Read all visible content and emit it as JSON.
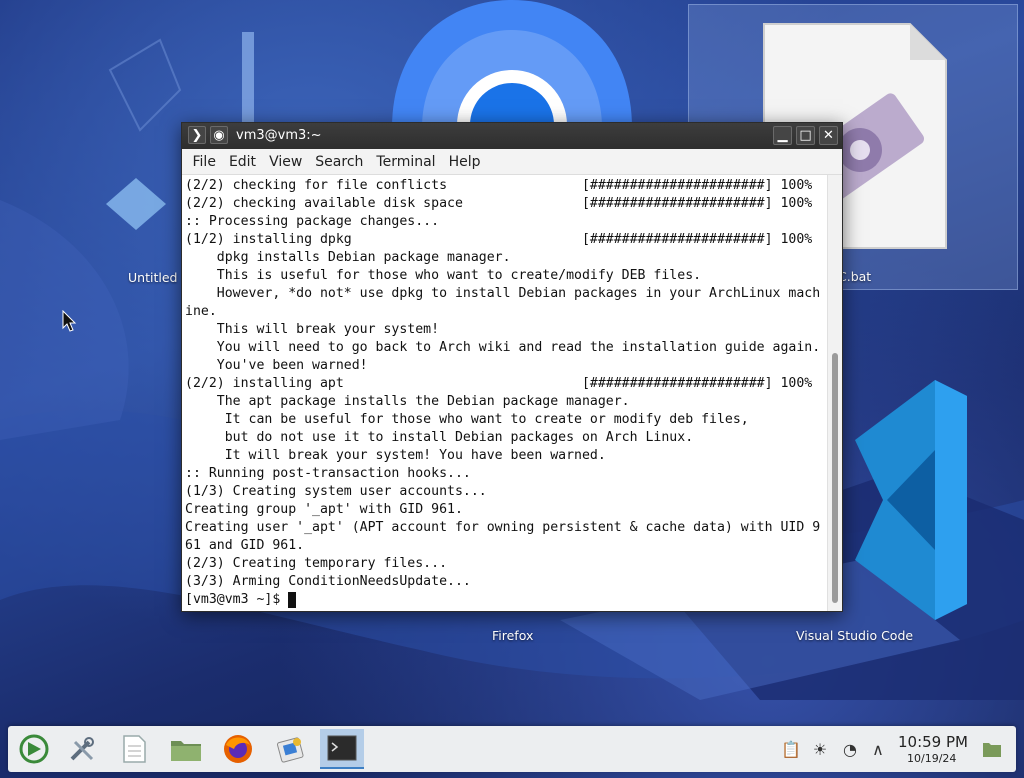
{
  "desktop": {
    "icons": [
      {
        "label": "Untitled"
      },
      {
        "label": "C.bat"
      },
      {
        "label": "Firefox"
      },
      {
        "label": "Visual Studio Code"
      }
    ]
  },
  "terminal": {
    "title": "vm3@vm3:~",
    "menu": [
      "File",
      "Edit",
      "View",
      "Search",
      "Terminal",
      "Help"
    ],
    "lines": [
      "(2/2) checking for file conflicts                 [######################] 100%",
      "(2/2) checking available disk space               [######################] 100%",
      ":: Processing package changes...",
      "(1/2) installing dpkg                             [######################] 100%",
      "    dpkg installs Debian package manager.",
      "    This is useful for those who want to create/modify DEB files.",
      "    However, *do not* use dpkg to install Debian packages in your ArchLinux mach",
      "ine.",
      "    This will break your system!",
      "    You will need to go back to Arch wiki and read the installation guide again.",
      "    You've been warned!",
      "(2/2) installing apt                              [######################] 100%",
      "    The apt package installs the Debian package manager.",
      "     It can be useful for those who want to create or modify deb files,",
      "     but do not use it to install Debian packages on Arch Linux.",
      "     It will break your system! You have been warned.",
      ":: Running post-transaction hooks...",
      "(1/3) Creating system user accounts...",
      "Creating group '_apt' with GID 961.",
      "Creating user '_apt' (APT account for owning persistent & cache data) with UID 9",
      "61 and GID 961.",
      "(2/3) Creating temporary files...",
      "(3/3) Arming ConditionNeedsUpdate..."
    ],
    "prompt": "[vm3@vm3 ~]$ "
  },
  "taskbar": {
    "clock_time": "10:59 PM",
    "clock_date": "10/19/24",
    "active_app": "terminal"
  },
  "colors": {
    "titlebar": "#2e2e2e",
    "taskbar": "#eceef0",
    "active_task": "#b4cde8"
  }
}
